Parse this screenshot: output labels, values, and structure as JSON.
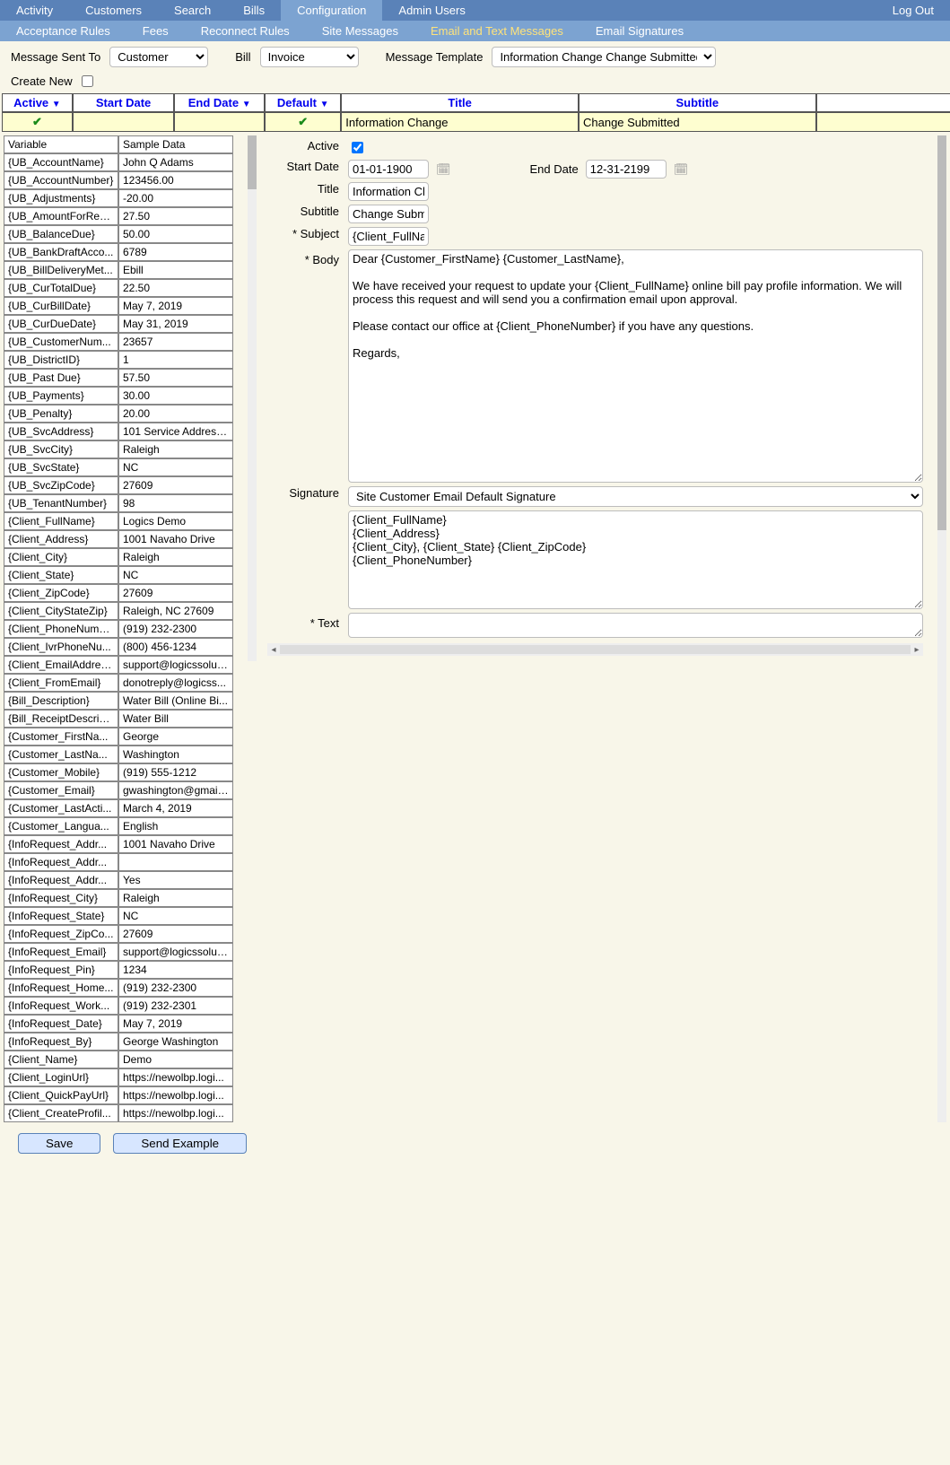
{
  "nav": {
    "items": [
      "Activity",
      "Customers",
      "Search",
      "Bills",
      "Configuration",
      "Admin Users"
    ],
    "active": 4,
    "right": "Log Out"
  },
  "subnav": {
    "items": [
      "Acceptance Rules",
      "Fees",
      "Reconnect Rules",
      "Site Messages",
      "Email and Text Messages",
      "Email Signatures"
    ],
    "active": 4
  },
  "filter": {
    "sent_label": "Message Sent To",
    "sent_value": "Customer",
    "bill_label": "Bill",
    "bill_value": "Invoice",
    "tpl_label": "Message Template",
    "tpl_value": "Information Change Change Submitted"
  },
  "create_new": "Create New",
  "cols": {
    "active": "Active",
    "start": "Start Date",
    "end": "End Date",
    "default": "Default",
    "title": "Title",
    "subtitle": "Subtitle"
  },
  "row": {
    "title": "Information Change",
    "subtitle": "Change Submitted"
  },
  "form": {
    "active_label": "Active",
    "active": true,
    "start_label": "Start Date",
    "start": "01-01-1900",
    "end_label": "End Date",
    "end": "12-31-2199",
    "title_label": "Title",
    "title": "Information Change",
    "subtitle_label": "Subtitle",
    "subtitle": "Change Submitted",
    "subject_label": "* Subject",
    "subject": "{Client_FullName} - Information Change Request Received",
    "body_label": "* Body",
    "body": "Dear {Customer_FirstName} {Customer_LastName},\n\nWe have received your request to update your {Client_FullName} online bill pay profile information. We will process this request and will send you a confirmation email upon approval.\n\nPlease contact our office at {Client_PhoneNumber} if you have any questions.\n\nRegards,",
    "sig_label": "Signature",
    "sig_select": "Site Customer Email Default Signature",
    "sig_text": "{Client_FullName}\n{Client_Address}\n{Client_City}, {Client_State} {Client_ZipCode}\n{Client_PhoneNumber}",
    "text_label": "* Text",
    "text": ""
  },
  "vars_header": {
    "v": "Variable",
    "s": "Sample Data"
  },
  "vars": [
    [
      "{UB_AccountName}",
      "John Q Adams"
    ],
    [
      "{UB_AccountNumber}",
      "123456.00"
    ],
    [
      "{UB_Adjustments}",
      "-20.00"
    ],
    [
      "{UB_AmountForRec...",
      "27.50"
    ],
    [
      "{UB_BalanceDue}",
      "50.00"
    ],
    [
      "{UB_BankDraftAcco...",
      "6789"
    ],
    [
      "{UB_BillDeliveryMet...",
      "Ebill"
    ],
    [
      "{UB_CurTotalDue}",
      "22.50"
    ],
    [
      "{UB_CurBillDate}",
      "May 7, 2019"
    ],
    [
      "{UB_CurDueDate}",
      "May 31, 2019"
    ],
    [
      "{UB_CustomerNum...",
      "23657"
    ],
    [
      "{UB_DistrictID}",
      "1"
    ],
    [
      "{UB_Past Due}",
      "57.50"
    ],
    [
      "{UB_Payments}",
      "30.00"
    ],
    [
      "{UB_Penalty}",
      "20.00"
    ],
    [
      "{UB_SvcAddress}",
      "101 Service Address..."
    ],
    [
      "{UB_SvcCity}",
      "Raleigh"
    ],
    [
      "{UB_SvcState}",
      "NC"
    ],
    [
      "{UB_SvcZipCode}",
      "27609"
    ],
    [
      "{UB_TenantNumber}",
      "98"
    ],
    [
      "{Client_FullName}",
      "Logics Demo"
    ],
    [
      "{Client_Address}",
      "1001 Navaho Drive"
    ],
    [
      "{Client_City}",
      "Raleigh"
    ],
    [
      "{Client_State}",
      "NC"
    ],
    [
      "{Client_ZipCode}",
      "27609"
    ],
    [
      "{Client_CityStateZip}",
      "Raleigh, NC 27609"
    ],
    [
      "{Client_PhoneNumb...",
      "(919) 232-2300"
    ],
    [
      "{Client_IvrPhoneNu...",
      "(800) 456-1234"
    ],
    [
      "{Client_EmailAddres...",
      "support@logicssolut..."
    ],
    [
      "{Client_FromEmail}",
      "donotreply@logicss..."
    ],
    [
      "{Bill_Description}",
      "Water Bill (Online Bi..."
    ],
    [
      "{Bill_ReceiptDescrip...",
      "Water Bill"
    ],
    [
      "{Customer_FirstNa...",
      "George"
    ],
    [
      "{Customer_LastNa...",
      "Washington"
    ],
    [
      "{Customer_Mobile}",
      "(919) 555-1212"
    ],
    [
      "{Customer_Email}",
      "gwashington@gmail..."
    ],
    [
      "{Customer_LastActi...",
      "March 4, 2019"
    ],
    [
      "{Customer_Langua...",
      "English"
    ],
    [
      "{InfoRequest_Addr...",
      "1001 Navaho Drive"
    ],
    [
      "{InfoRequest_Addr...",
      ""
    ],
    [
      "{InfoRequest_Addr...",
      "Yes"
    ],
    [
      "{InfoRequest_City}",
      "Raleigh"
    ],
    [
      "{InfoRequest_State}",
      "NC"
    ],
    [
      "{InfoRequest_ZipCo...",
      "27609"
    ],
    [
      "{InfoRequest_Email}",
      "support@logicssolut..."
    ],
    [
      "{InfoRequest_Pin}",
      "1234"
    ],
    [
      "{InfoRequest_Home...",
      "(919) 232-2300"
    ],
    [
      "{InfoRequest_Work...",
      "(919) 232-2301"
    ],
    [
      "{InfoRequest_Date}",
      "May 7, 2019"
    ],
    [
      "{InfoRequest_By}",
      "George Washington"
    ],
    [
      "{Client_Name}",
      "Demo"
    ],
    [
      "{Client_LoginUrl}",
      "https://newolbp.logi..."
    ],
    [
      "{Client_QuickPayUrl}",
      "https://newolbp.logi..."
    ],
    [
      "{Client_CreateProfil...",
      "https://newolbp.logi..."
    ]
  ],
  "buttons": {
    "save": "Save",
    "send": "Send Example"
  }
}
